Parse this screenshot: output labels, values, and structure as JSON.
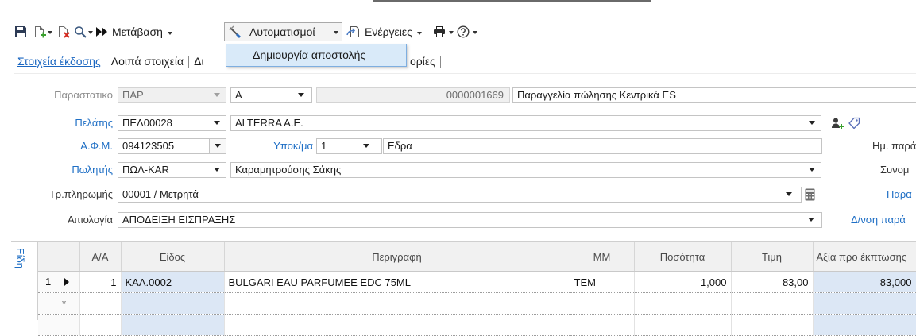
{
  "toolbar": {
    "goto_label": "Μετάβαση",
    "automations_label": "Αυτοματισμοί",
    "actions_label": "Ενέργειες",
    "icons": [
      "save-icon",
      "new-document-icon",
      "delete-document-icon",
      "search-icon",
      "fast-forward-icon",
      "automation-icon",
      "actions-icon",
      "printer-icon",
      "help-icon"
    ]
  },
  "automations_menu": {
    "items": [
      {
        "label": "Δημιουργία αποστολής"
      }
    ]
  },
  "tabs": [
    {
      "label": "Στοιχεία έκδοσης",
      "active": true
    },
    {
      "label": "Λοιπά στοιχεία"
    },
    {
      "label": "Δι"
    },
    {
      "label": "ορίες"
    }
  ],
  "form": {
    "document": {
      "label": "Παραστατικό",
      "series": "ΠΑΡ",
      "type": "Α",
      "number": "0000001669",
      "description": "Παραγγελία πώλησης Κεντρικά ES"
    },
    "customer": {
      "label": "Πελάτης",
      "code": "ΠΕΛ00028",
      "name": "ALTERRA A.E."
    },
    "vat": {
      "label": "Α.Φ.Μ.",
      "value": "094123505"
    },
    "branch": {
      "label": "Υποκ/μα",
      "code": "1",
      "name": "Εδρα"
    },
    "salesperson": {
      "label": "Πωλητής",
      "code": "ΠΩΛ-KAR",
      "name": "Καραμητρούσης Σάκης"
    },
    "payment": {
      "label": "Τρ.πληρωμής",
      "value": "00001 / Μετρητά"
    },
    "reason": {
      "label": "Αιτιολογία",
      "value": "ΑΠΟΔΕΙΞΗ ΕΙΣΠΡΑΞΗΣ"
    },
    "right_labels": {
      "delivery_date": "Ημ. παρά",
      "contact": "Συνομ",
      "other": "Παρα",
      "delivery_address": "Δ/νση παρά"
    }
  },
  "grid": {
    "tab_label": "Είδη",
    "columns": [
      "Α/Α",
      "Είδος",
      "Περιγραφή",
      "ΜΜ",
      "Ποσότητα",
      "Τιμή",
      "Αξία προ έκπτωσης"
    ],
    "rows": [
      {
        "row_no": "1",
        "aa": "1",
        "item": "ΚΑΛ.0002",
        "description": "BULGARI EAU PARFUMEE EDC 75ML",
        "unit": "ΤΕΜ",
        "quantity": "1,000",
        "price": "83,00",
        "gross_value": "83,000"
      }
    ],
    "new_row_marker": "*"
  },
  "colors": {
    "link": "#1f6fc5",
    "active_tab": "#1a66c1",
    "menu_highlight": "#d9eaf9",
    "grid_highlight": "#dce7f5"
  }
}
